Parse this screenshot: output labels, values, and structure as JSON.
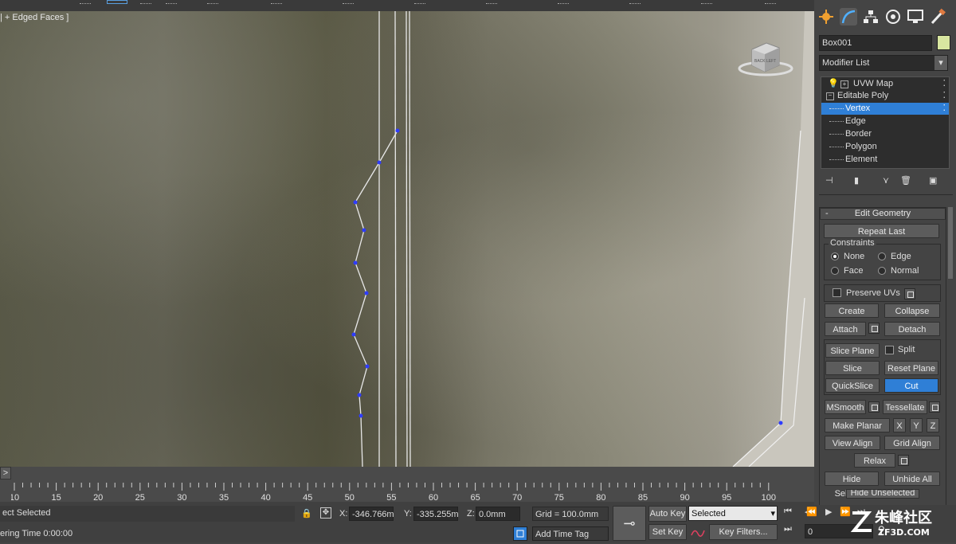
{
  "viewport": {
    "label": "| + Edged Faces ]",
    "viewcube_text": "BACK  LEFT"
  },
  "panel": {
    "tabs": [
      "create-icon",
      "modify-icon",
      "hierarchy-icon",
      "motion-icon",
      "display-icon",
      "utilities-icon"
    ],
    "object_name": "Box001",
    "object_color": "#d8e6a0",
    "modifier_list": "Modifier List",
    "stack": [
      "UVW Map",
      "Editable Poly",
      "Vertex",
      "Edge",
      "Border",
      "Polygon",
      "Element"
    ],
    "rollout_title": "Edit Geometry",
    "repeat_last": "Repeat Last",
    "constraints_label": "Constraints",
    "constraints": [
      "None",
      "Edge",
      "Face",
      "Normal"
    ],
    "preserve_uvs": "Preserve UVs",
    "create": "Create",
    "collapse": "Collapse",
    "attach": "Attach",
    "detach": "Detach",
    "slice_plane": "Slice Plane",
    "split": "Split",
    "slice": "Slice",
    "reset_plane": "Reset Plane",
    "quickslice": "QuickSlice",
    "cut": "Cut",
    "msmooth": "MSmooth",
    "tessellate": "Tessellate",
    "make_planar": "Make Planar",
    "x": "X",
    "y": "Y",
    "z": "Z",
    "view_align": "View Align",
    "grid_align": "Grid Align",
    "relax": "Relax",
    "hide_selected": "Hide Selected",
    "unhide_all": "Unhide All",
    "hide_unselected": "Hide Unselected",
    "accent": "#2f7fd6"
  },
  "timeline": {
    "expander": ">",
    "ticks": [
      "10",
      "15",
      "20",
      "25",
      "30",
      "35",
      "40",
      "45",
      "50",
      "55",
      "60",
      "65",
      "70",
      "75",
      "80",
      "85",
      "90",
      "95",
      "100"
    ]
  },
  "status": {
    "selection": "ect Selected",
    "rendering": "ering Time  0:00:00",
    "x_label": "X:",
    "x_value": "-346.766m",
    "y_label": "Y:",
    "y_value": "-335.255m",
    "z_label": "Z:",
    "z_value": "0.0mm",
    "grid": "Grid = 100.0mm",
    "auto_key": "Auto Key",
    "set_key": "Set Key",
    "key_mode": "Selected",
    "key_filters": "Key Filters...",
    "add_time_tag": "Add Time Tag",
    "frame": "0"
  },
  "watermark": {
    "text": "朱峰社区",
    "url": "ZF3D.COM"
  }
}
